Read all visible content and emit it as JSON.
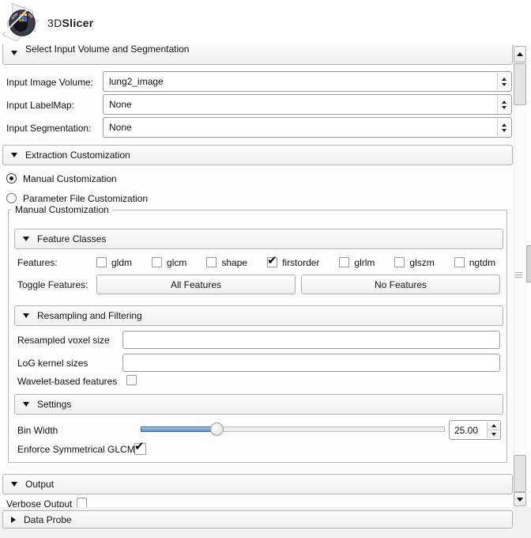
{
  "app": {
    "logo_3d": "3D",
    "logo_slicer": "Slicer"
  },
  "input_section": {
    "title": "Select Input Volume and Segmentation",
    "rows": [
      {
        "label": "Input Image Volume:",
        "value": "lung2_image"
      },
      {
        "label": "Input LabelMap:",
        "value": "None"
      },
      {
        "label": "Input Segmentation:",
        "value": "None"
      }
    ]
  },
  "extraction_section": {
    "title": "Extraction Customization",
    "radio_manual": "Manual Customization",
    "radio_manual_selected": true,
    "radio_parameter": "Parameter File Customization",
    "radio_parameter_selected": false,
    "groupbox_title": "Manual Customization",
    "feature_classes": {
      "title": "Feature Classes",
      "features_label": "Features:",
      "features": [
        {
          "label": "gldm",
          "checked": false
        },
        {
          "label": "glcm",
          "checked": false
        },
        {
          "label": "shape",
          "checked": false
        },
        {
          "label": "firstorder",
          "checked": true
        },
        {
          "label": "glrlm",
          "checked": false
        },
        {
          "label": "glszm",
          "checked": false
        },
        {
          "label": "ngtdm",
          "checked": false
        }
      ],
      "toggle_label": "Toggle Features:",
      "all_features_button": "All Features",
      "no_features_button": "No Features"
    },
    "resampling": {
      "title": "Resampling and Filtering",
      "resampled_label": "Resampled voxel size",
      "resampled_value": "",
      "log_label": "LoG kernel sizes",
      "log_value": "",
      "wavelet_label": "Wavelet-based features",
      "wavelet_checked": false
    },
    "settings": {
      "title": "Settings",
      "bin_width_label": "Bin Width",
      "bin_width_value": "25.00",
      "glcm_label": "Enforce Symmetrical GLCM",
      "glcm_checked": true
    }
  },
  "output_section": {
    "title": "Output",
    "verbose_label": "Verbose Output",
    "verbose_checked": false
  },
  "data_probe_section": {
    "title": "Data Probe"
  },
  "colors": {
    "slider_fill": "#5f8fc4",
    "slider_border": "#3f6da0",
    "panel_bg": "#fdfdfd"
  }
}
